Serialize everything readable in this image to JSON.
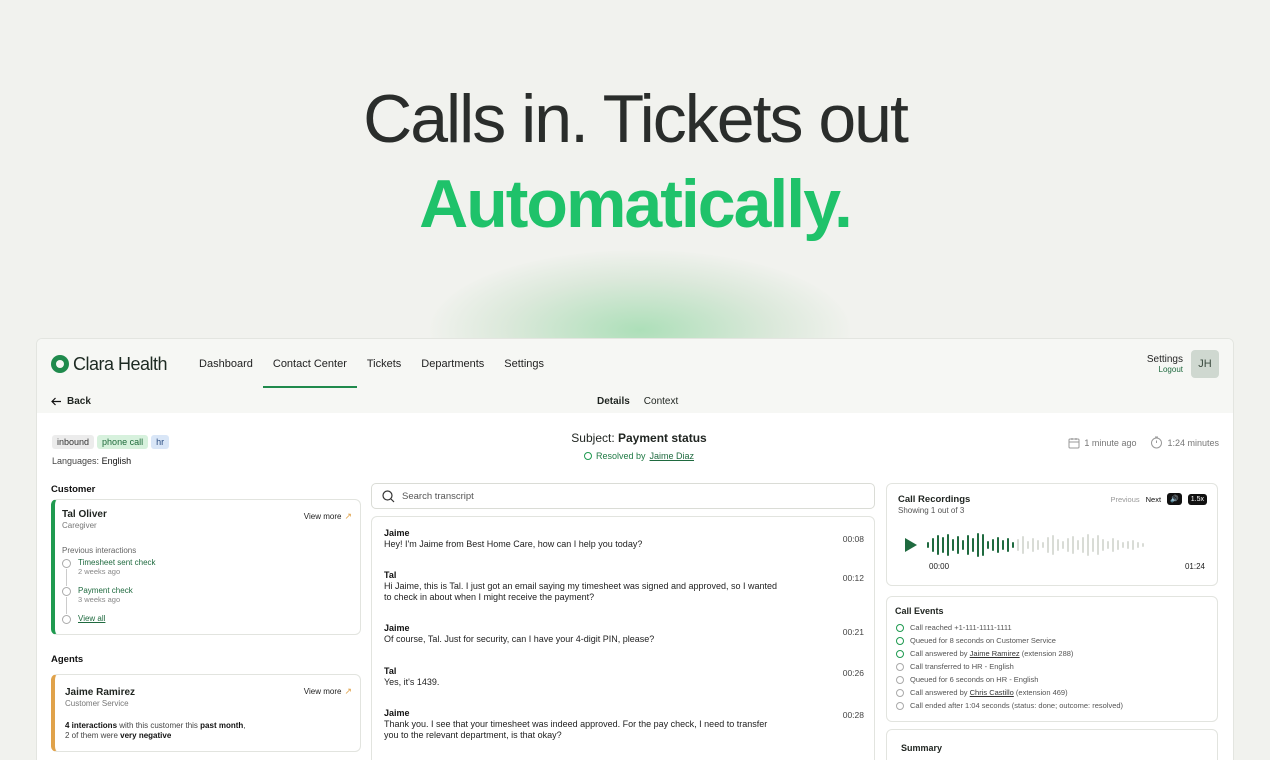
{
  "hero": {
    "line1": "Calls in. Tickets out",
    "line2": "Automatically."
  },
  "app": {
    "logo": "Clara Health",
    "nav": [
      {
        "label": "Dashboard"
      },
      {
        "label": "Contact Center",
        "active": true
      },
      {
        "label": "Tickets"
      },
      {
        "label": "Departments"
      },
      {
        "label": "Settings"
      }
    ],
    "settings_label": "Settings",
    "logout_label": "Logout",
    "avatar_initials": "JH"
  },
  "subbar": {
    "back_label": "Back",
    "tabs": [
      "Details",
      "Context"
    ]
  },
  "ticket": {
    "tags": [
      "inbound",
      "phone call",
      "hr"
    ],
    "languages_label": "Languages:",
    "languages_value": "English",
    "subject_prefix": "Subject:",
    "subject": "Payment status",
    "resolved_prefix": "Resolved by",
    "resolved_by": "Jaime Diaz",
    "time_ago": "1 minute ago",
    "duration": "1:24 minutes"
  },
  "customer": {
    "section_title": "Customer",
    "name": "Tal Oliver",
    "role": "Caregiver",
    "view_more": "View more",
    "previous_label": "Previous interactions",
    "interactions": [
      {
        "title": "Timesheet sent check",
        "time": "2 weeks ago"
      },
      {
        "title": "Payment check",
        "time": "3 weeks ago"
      }
    ],
    "view_all": "View all"
  },
  "agents": {
    "section_title": "Agents",
    "name": "Jaime Ramirez",
    "role": "Customer Service",
    "view_more": "View more",
    "stat_interactions": "4 interactions",
    "stat_mid": " with this customer this ",
    "stat_period": "past month",
    "stat_end": ",",
    "stat2_prefix": "2 of them were ",
    "stat2_value": "very negative"
  },
  "search": {
    "placeholder": "Search transcript"
  },
  "transcript": [
    {
      "speaker": "Jaime",
      "text": "Hey! I'm Jaime from Best Home Care, how can I help you today?",
      "time": "00:08"
    },
    {
      "speaker": "Tal",
      "text": "Hi Jaime, this is Tal. I just got an email saying my timesheet was signed and approved, so I wanted to check in about when I might receive the payment?",
      "time": "00:12"
    },
    {
      "speaker": "Jaime",
      "text": "Of course, Tal. Just for security, can I have your 4-digit PIN, please?",
      "time": "00:21"
    },
    {
      "speaker": "Tal",
      "text": "Yes, it's 1439.",
      "time": "00:26"
    },
    {
      "speaker": "Jaime",
      "text": "Thank you. I see that your timesheet was indeed approved. For the pay check, I need to transfer you to the relevant department, is that okay?",
      "time": "00:28"
    }
  ],
  "recordings": {
    "title": "Call Recordings",
    "subtitle": "Showing 1 out of 3",
    "previous": "Previous",
    "next": "Next",
    "speed": "1.5x",
    "start": "00:00",
    "end": "01:24"
  },
  "events": {
    "title": "Call Events",
    "items": [
      {
        "text": "Call reached +1-111-1111-1111",
        "done": true
      },
      {
        "text": "Queued for 8 seconds on Customer Service",
        "done": true
      },
      {
        "prefix": "Call answered by ",
        "link": "Jaime Ramirez",
        "suffix": " (extension 288)",
        "done": true
      },
      {
        "text": "Call transferred to HR - English",
        "done": false
      },
      {
        "text": "Queued for 6 seconds on HR - English",
        "done": false
      },
      {
        "prefix": "Call answered by ",
        "link": "Chris Castillo",
        "suffix": " (extension 469)",
        "done": false
      },
      {
        "text": "Call ended after 1:04 seconds (status: done; outcome: resolved)",
        "done": false
      }
    ]
  },
  "summary": {
    "title": "Summary"
  },
  "colors": {
    "brand": "#1f8a4c",
    "accent_green": "#1fc26a",
    "agent_accent": "#e0a24a"
  }
}
